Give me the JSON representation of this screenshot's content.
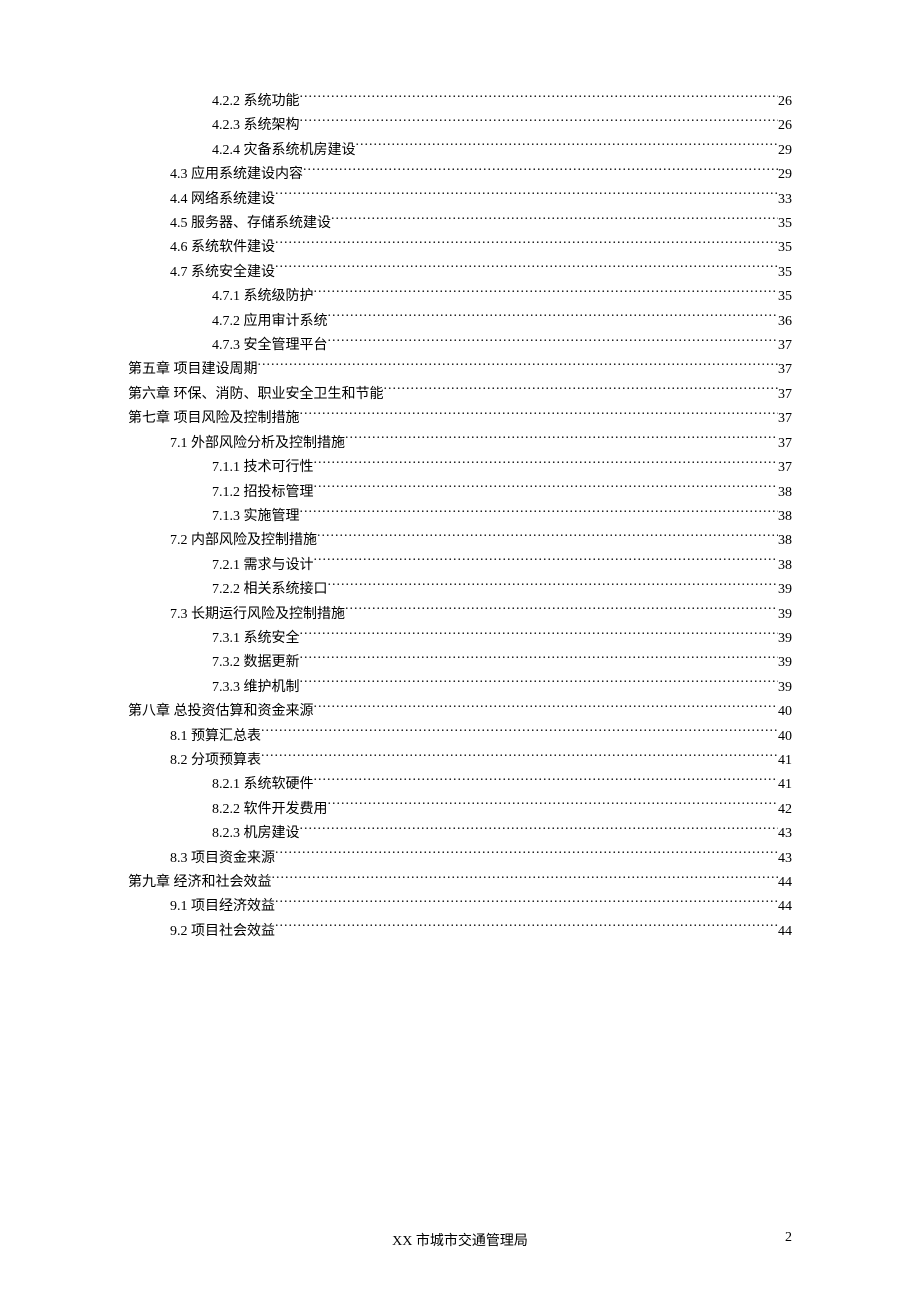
{
  "toc": [
    {
      "level": 2,
      "label": "4.2.2 系统功能",
      "page": "26"
    },
    {
      "level": 2,
      "label": "4.2.3 系统架构",
      "page": "26"
    },
    {
      "level": 2,
      "label": "4.2.4 灾备系统机房建设",
      "page": "29"
    },
    {
      "level": 1,
      "label": "4.3 应用系统建设内容",
      "page": "29"
    },
    {
      "level": 1,
      "label": "4.4 网络系统建设",
      "page": "33"
    },
    {
      "level": 1,
      "label": "4.5 服务器、存储系统建设",
      "page": "35"
    },
    {
      "level": 1,
      "label": "4.6 系统软件建设",
      "page": "35"
    },
    {
      "level": 1,
      "label": "4.7 系统安全建设",
      "page": "35"
    },
    {
      "level": 2,
      "label": "4.7.1 系统级防护",
      "page": "35"
    },
    {
      "level": 2,
      "label": "4.7.2 应用审计系统",
      "page": "36"
    },
    {
      "level": 2,
      "label": "4.7.3 安全管理平台",
      "page": "37"
    },
    {
      "level": 0,
      "label": "第五章  项目建设周期",
      "page": "37"
    },
    {
      "level": 0,
      "label": "第六章  环保、消防、职业安全卫生和节能",
      "page": "37"
    },
    {
      "level": 0,
      "label": "第七章  项目风险及控制措施",
      "page": "37"
    },
    {
      "level": 1,
      "label": "7.1 外部风险分析及控制措施",
      "page": "37"
    },
    {
      "level": 2,
      "label": "7.1.1 技术可行性",
      "page": "37"
    },
    {
      "level": 2,
      "label": "7.1.2 招投标管理",
      "page": "38"
    },
    {
      "level": 2,
      "label": "7.1.3 实施管理",
      "page": "38"
    },
    {
      "level": 1,
      "label": "7.2 内部风险及控制措施",
      "page": "38"
    },
    {
      "level": 2,
      "label": "7.2.1 需求与设计",
      "page": "38"
    },
    {
      "level": 2,
      "label": "7.2.2 相关系统接口",
      "page": "39"
    },
    {
      "level": 1,
      "label": "7.3 长期运行风险及控制措施",
      "page": "39"
    },
    {
      "level": 2,
      "label": "7.3.1 系统安全",
      "page": "39"
    },
    {
      "level": 2,
      "label": "7.3.2 数据更新",
      "page": "39"
    },
    {
      "level": 2,
      "label": "7.3.3 维护机制",
      "page": "39"
    },
    {
      "level": 0,
      "label": "第八章  总投资估算和资金来源",
      "page": "40"
    },
    {
      "level": 1,
      "label": "8.1 预算汇总表",
      "page": "40"
    },
    {
      "level": 1,
      "label": "8.2 分项预算表",
      "page": "41"
    },
    {
      "level": 2,
      "label": "8.2.1 系统软硬件",
      "page": "41"
    },
    {
      "level": 2,
      "label": "8.2.2 软件开发费用",
      "page": "42"
    },
    {
      "level": 2,
      "label": "8.2.3 机房建设",
      "page": "43"
    },
    {
      "level": 1,
      "label": "8.3 项目资金来源",
      "page": "43"
    },
    {
      "level": 0,
      "label": "第九章  经济和社会效益",
      "page": "44"
    },
    {
      "level": 1,
      "label": "9.1 项目经济效益",
      "page": "44"
    },
    {
      "level": 1,
      "label": "9.2 项目社会效益",
      "page": "44"
    }
  ],
  "footer": {
    "center": "XX 市城市交通管理局",
    "page_number": "2"
  }
}
